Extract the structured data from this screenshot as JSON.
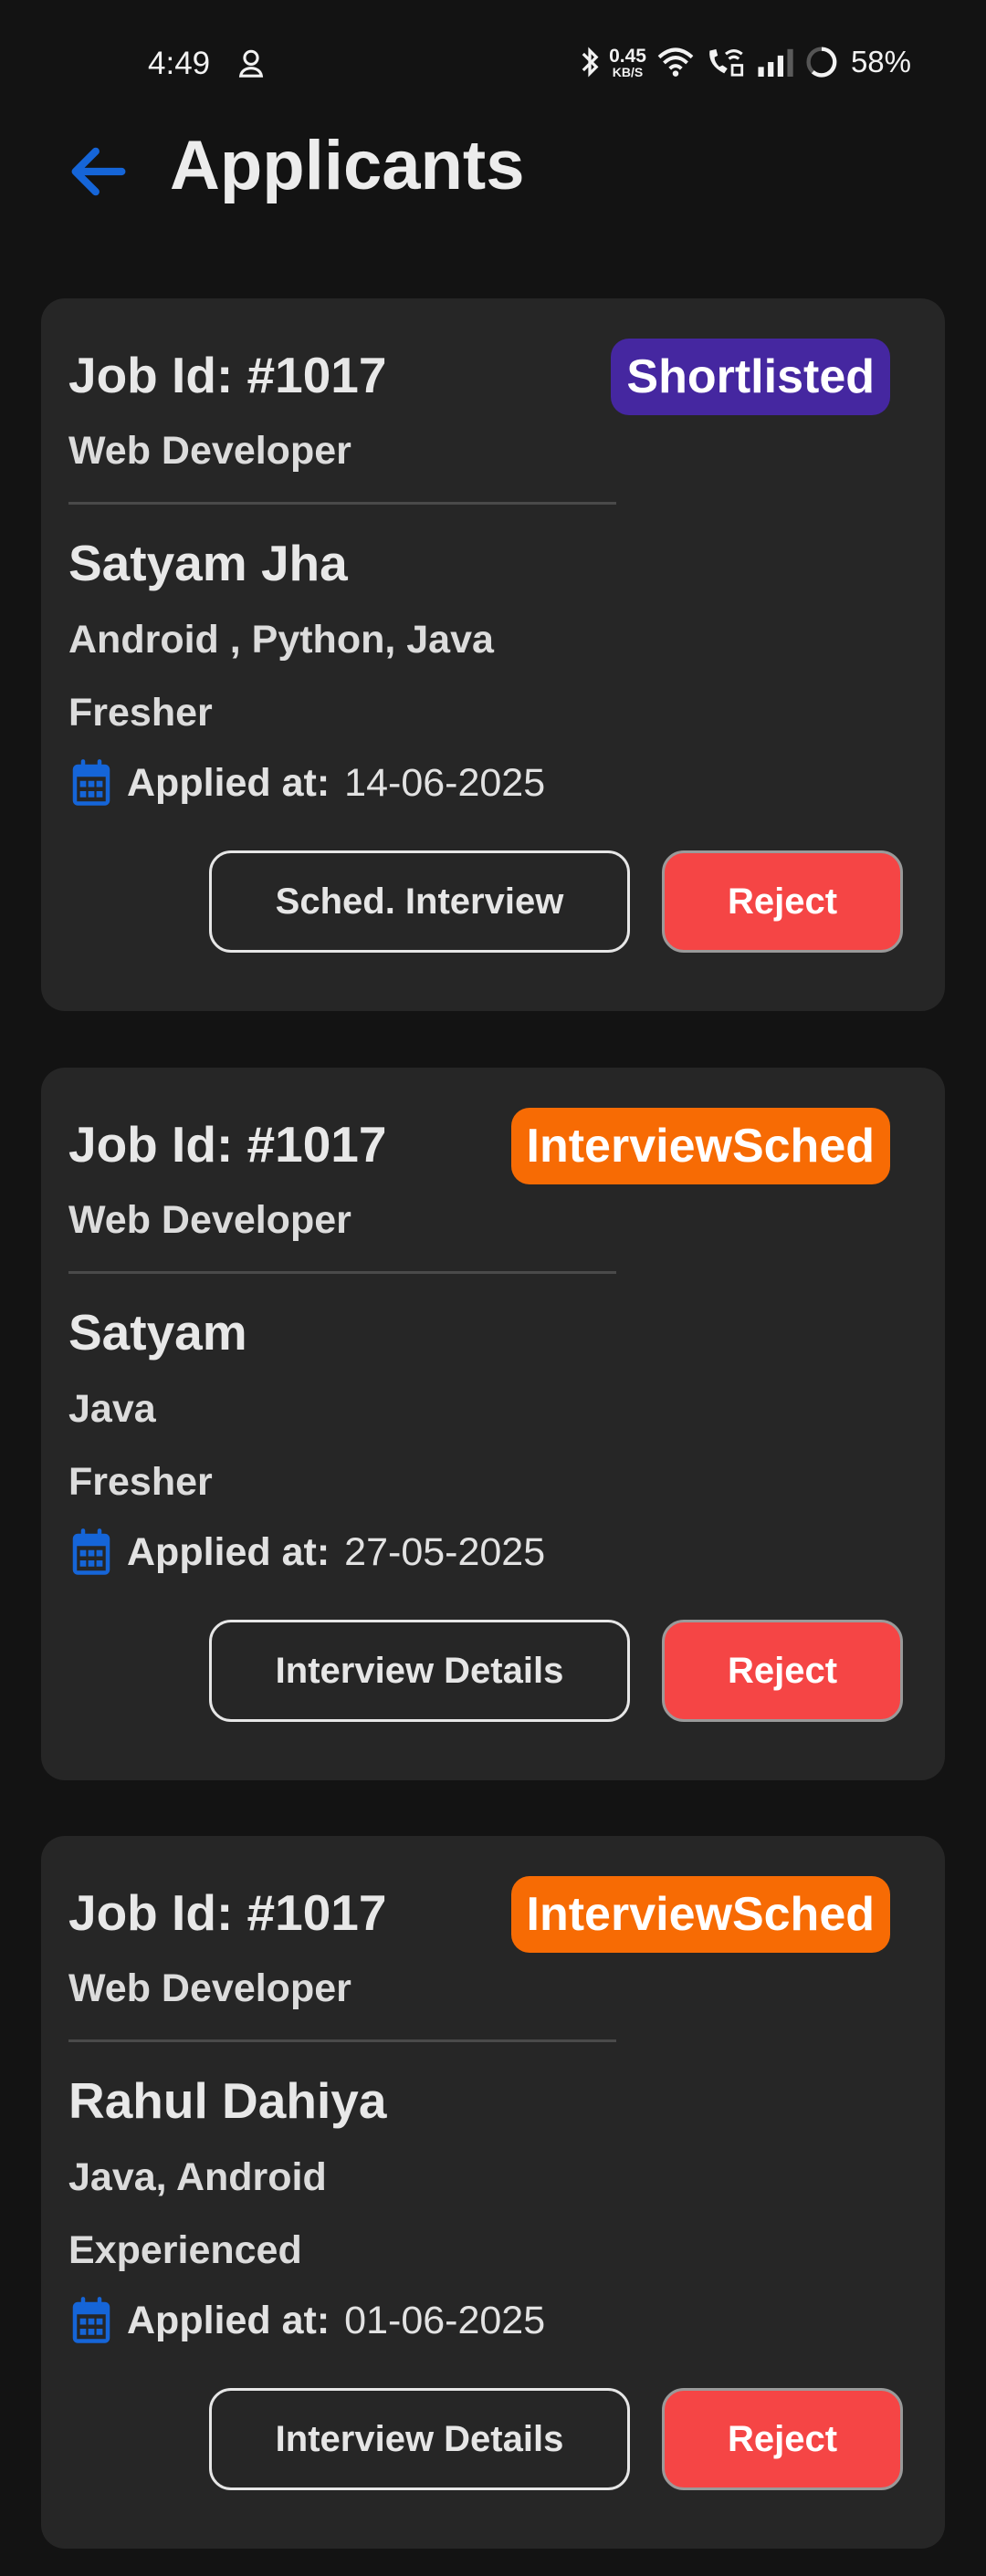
{
  "status_bar": {
    "time": "4:49",
    "net_speed_value": "0.45",
    "net_speed_unit": "KB/S",
    "battery_percent": "58%",
    "icons": [
      "person-icon",
      "bluetooth-icon",
      "wifi-icon",
      "wifi-call-icon",
      "signal-icon",
      "battery-ring-icon"
    ]
  },
  "header": {
    "title": "Applicants",
    "back_icon": "arrow-left-icon"
  },
  "colors": {
    "background": "#131313",
    "card": "#262626",
    "accent_blue": "#1565d8",
    "shortlisted": "#4527a0",
    "interview_scheduled": "#f76b04",
    "reject": "#f54545"
  },
  "labels": {
    "applied_at": "Applied at:",
    "reject": "Reject"
  },
  "applicants": [
    {
      "job_id": "Job Id: #1017",
      "job_title": "Web Developer",
      "status": "Shortlisted",
      "name": "Satyam Jha",
      "skills": "Android , Python, Java",
      "experience": "Fresher",
      "applied_date": "14-06-2025",
      "primary_action": "Sched. Interview",
      "reject": "Reject"
    },
    {
      "job_id": "Job Id: #1017",
      "job_title": "Web Developer",
      "status": "InterviewSched",
      "name": "Satyam",
      "skills": "Java",
      "experience": "Fresher",
      "applied_date": "27-05-2025",
      "primary_action": "Interview Details",
      "reject": "Reject"
    },
    {
      "job_id": "Job Id: #1017",
      "job_title": "Web Developer",
      "status": "InterviewSched",
      "name": "Rahul Dahiya",
      "skills": "Java, Android",
      "experience": "Experienced",
      "applied_date": "01-06-2025",
      "primary_action": "Interview Details",
      "reject": "Reject"
    }
  ]
}
